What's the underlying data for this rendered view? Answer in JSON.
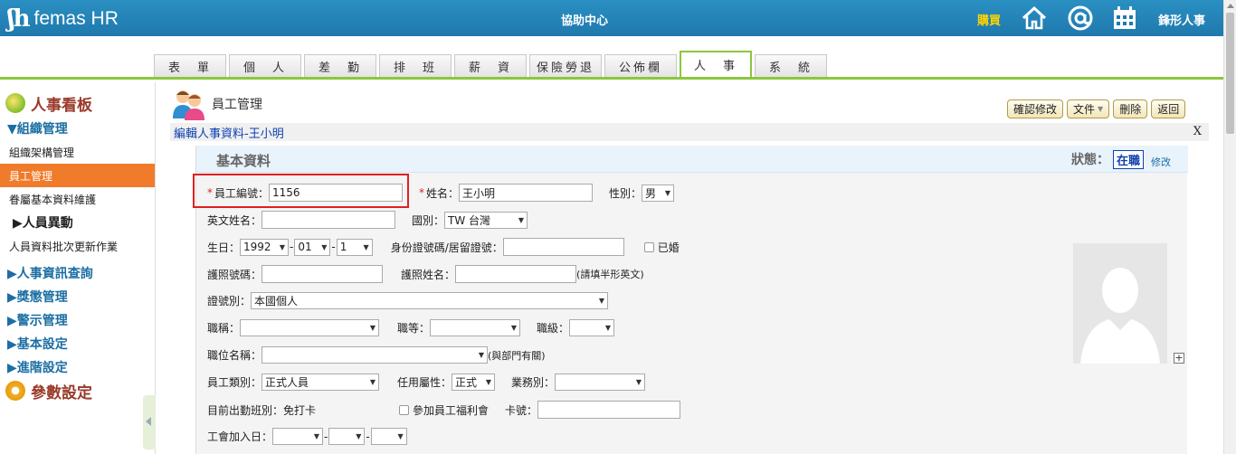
{
  "header": {
    "logo_text": "femas HR",
    "help_center": "協助中心",
    "buy": "購買",
    "user": "鋒形人事",
    "icons": [
      "home-icon",
      "at-icon",
      "calendar-icon"
    ]
  },
  "tabs": [
    {
      "label": "表　單",
      "active": false
    },
    {
      "label": "個　人",
      "active": false
    },
    {
      "label": "差　勤",
      "active": false
    },
    {
      "label": "排　班",
      "active": false
    },
    {
      "label": "薪　資",
      "active": false
    },
    {
      "label": "保險勞退",
      "active": false
    },
    {
      "label": "公佈欄",
      "active": false
    },
    {
      "label": "人　事",
      "active": true
    },
    {
      "label": "系　統",
      "active": false
    }
  ],
  "sidebar": {
    "title": "人事看板",
    "org_group": "▼組織管理",
    "items": [
      "組織架構管理",
      "員工管理",
      "眷屬基本資料維護"
    ],
    "personnel_change": "▶人員異動",
    "batch_update": "人員資料批次更新作業",
    "groups": [
      "▶人事資訊查詢",
      "▶獎懲管理",
      "▶警示管理",
      "▶基本設定",
      "▶進階設定"
    ],
    "params": "參數設定"
  },
  "page": {
    "title": "員工管理",
    "buttons": {
      "confirm": "確認修改",
      "doc": "文件",
      "delete": "刪除",
      "back": "返回"
    },
    "edit_title": "編輯人事資料-王小明",
    "close": "X"
  },
  "panel": {
    "title": "基本資料",
    "status_label": "狀態：",
    "status_value": "在職",
    "modify": "修改"
  },
  "form": {
    "emp_no_label": "員工編號：",
    "emp_no": "1156",
    "name_label": "姓名：",
    "name": "王小明",
    "gender_label": "性別：",
    "gender": "男",
    "en_name_label": "英文姓名：",
    "en_name": "",
    "country_label": "國別：",
    "country": "TW 台灣",
    "birth_label": "生日：",
    "birth_year": "1992",
    "birth_month": "01",
    "birth_day": "1",
    "id_label": "身份證號碼/居留證號：",
    "id_value": "",
    "married_label": "已婚",
    "passport_no_label": "護照號碼：",
    "passport_no": "",
    "passport_name_label": "護照姓名：",
    "passport_name": "",
    "passport_hint": "(請填半形英文)",
    "id_type_label": "證號別：",
    "id_type": "本國個人",
    "title_label": "職稱：",
    "title_value": "",
    "grade_label": "職等：",
    "grade_value": "",
    "level_label": "職級：",
    "level_value": "",
    "position_label": "職位名稱：",
    "position_value": "",
    "position_hint": "(與部門有關)",
    "emp_type_label": "員工類別：",
    "emp_type": "正式人員",
    "hire_type_label": "任用屬性：",
    "hire_type": "正式",
    "business_label": "業務別：",
    "business_value": "",
    "shift_label": "目前出勤班別：免打卡",
    "welfare_label": "參加員工福利會",
    "card_label": "卡號：",
    "card_value": "",
    "union_label": "工會加入日："
  }
}
